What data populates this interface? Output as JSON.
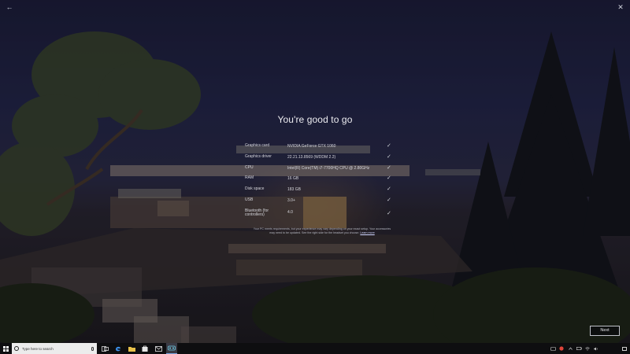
{
  "window": {
    "back_glyph": "←",
    "close_glyph": "✕"
  },
  "main": {
    "heading": "You're good to go",
    "checks": [
      {
        "label": "Graphics card",
        "value": "NVIDIA GeForce GTX 1060",
        "status": "pass"
      },
      {
        "label": "Graphics driver",
        "value": "22.21.13.8569 (WDDM 2.2)",
        "status": "pass"
      },
      {
        "label": "CPU",
        "value": "Intel(R) Core(TM) i7-7700HQ CPU @ 2.80GHz",
        "status": "pass"
      },
      {
        "label": "RAM",
        "value": "16 GB",
        "status": "pass"
      },
      {
        "label": "Disk space",
        "value": "183 GB",
        "status": "pass"
      },
      {
        "label": "USB",
        "value": "3.0+",
        "status": "pass"
      },
      {
        "label": "Bluetooth (for controllers)",
        "value": "4.0",
        "status": "pass"
      }
    ],
    "check_mark": "✓",
    "note_text": "Your PC meets requirements, but your experience may vary depending on your exact setup. Your accessories may need to be updated. See the right side for the headset you choose.",
    "note_link": "Learn more",
    "next_label": "Next"
  },
  "taskbar": {
    "search_placeholder": "Type here to search",
    "apps": [
      "task-view",
      "edge",
      "file-explorer",
      "store",
      "mail",
      "mixed-reality-portal"
    ],
    "clock_time": "",
    "clock_date": ""
  },
  "colors": {
    "accent": "#77a3e0",
    "taskbar_bg": "#0e0e10",
    "alert_red": "#e0453a"
  }
}
